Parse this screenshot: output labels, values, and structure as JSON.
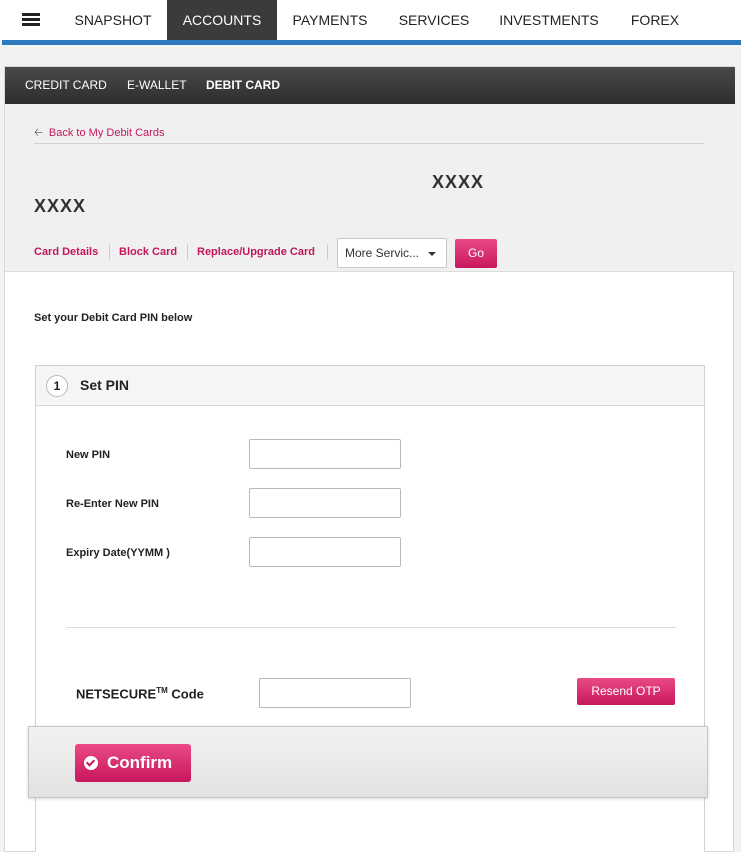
{
  "topnav": {
    "items": [
      "SNAPSHOT",
      "ACCOUNTS",
      "PAYMENTS",
      "SERVICES",
      "INVESTMENTS",
      "FOREX"
    ],
    "active": "ACCOUNTS"
  },
  "subnav": {
    "items": [
      "CREDIT CARD",
      "E-WALLET",
      "DEBIT CARD"
    ],
    "active": "DEBIT CARD"
  },
  "card": {
    "back_link": "Back to My Debit Cards",
    "number_right": "XXXX",
    "number_left": "XXXX",
    "actions": [
      "Card Details",
      "Block Card",
      "Replace/Upgrade Card"
    ],
    "more_select": "More Servic...",
    "go_label": "Go"
  },
  "form": {
    "intro": "Set your Debit Card PIN below",
    "step_number": "1",
    "step_title": "Set PIN",
    "fields": [
      {
        "label": "New PIN",
        "value": ""
      },
      {
        "label": "Re-Enter New PIN",
        "value": ""
      },
      {
        "label": "Expiry Date(YYMM )",
        "value": ""
      }
    ],
    "netsecure_label": "NETSECURE",
    "netsecure_tm": "TM",
    "netsecure_suffix": " Code",
    "resend_label": "Resend OTP",
    "confirm_label": "Confirm"
  },
  "colors": {
    "accent": "#c8175d",
    "nav_active": "#3b3b3b",
    "blue_bar": "#2d7bbf"
  },
  "icons": {
    "menu": "hamburger-menu-icon",
    "back": "arrow-left-icon",
    "dropdown": "caret-down-icon",
    "confirm": "check-circle-icon"
  }
}
